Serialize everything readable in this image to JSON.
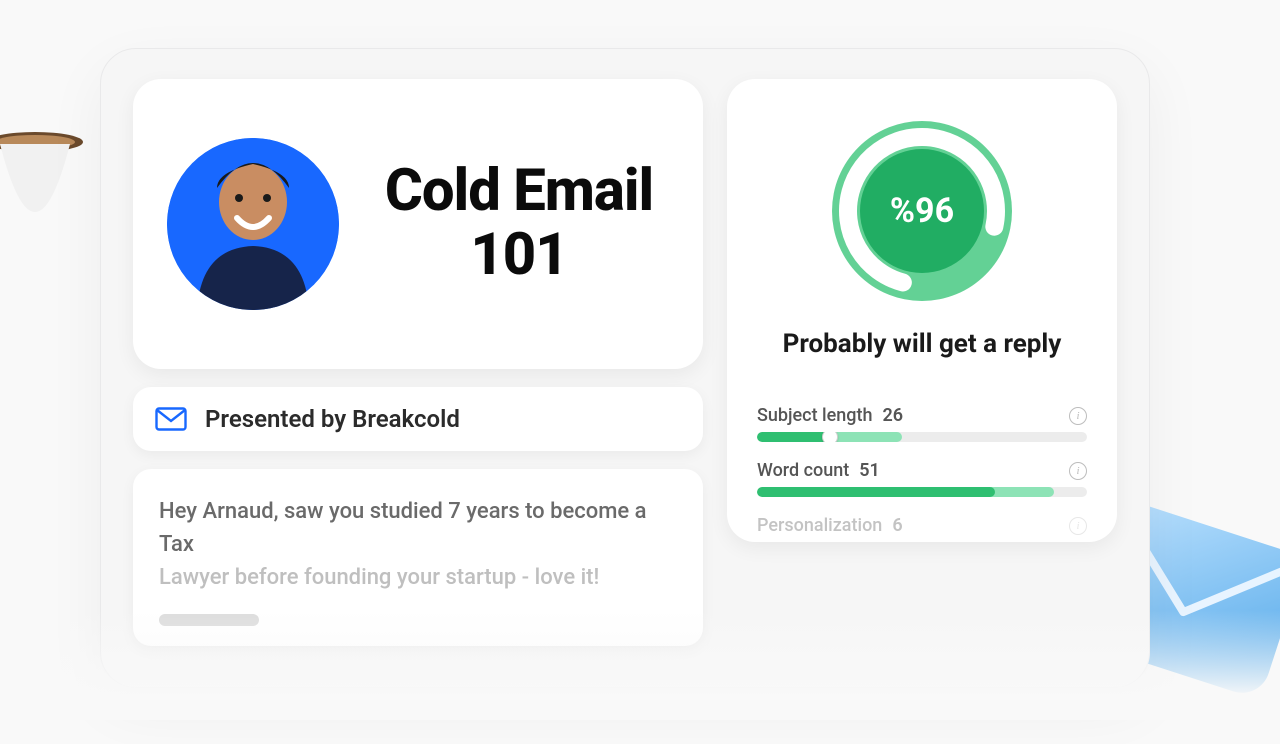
{
  "hero": {
    "title": "Cold Email 101"
  },
  "presented": {
    "label": "Presented by Breakcold"
  },
  "body": {
    "line1": "Hey Arnaud, saw you studied 7 years to become a Tax",
    "line2": "Lawyer before founding your startup - love it!"
  },
  "analysis": {
    "score_text": "%96",
    "score_percent": 96,
    "headline": "Probably will get a reply",
    "metrics": [
      {
        "label": "Subject length",
        "value": "26",
        "fill_percent": 22,
        "track_percent": 44,
        "color_fill": "#2fbf71",
        "color_track": "#8de3b6",
        "show_handle": true
      },
      {
        "label": "Word count",
        "value": "51",
        "fill_percent": 72,
        "track_percent": 90,
        "color_fill": "#2fbf71",
        "color_track": "#8de3b6",
        "show_handle": false
      },
      {
        "label": "Personalization",
        "value": "6",
        "fill_percent": 0,
        "track_percent": 0,
        "color_fill": "#2fbf71",
        "color_track": "#8de3b6",
        "show_handle": false
      }
    ]
  },
  "colors": {
    "donut_outer": "#63d195",
    "donut_arc": "#ffffff",
    "donut_inner": "#21ad63",
    "avatar_bg": "#1868ff",
    "mail_stroke": "#1868ff"
  }
}
